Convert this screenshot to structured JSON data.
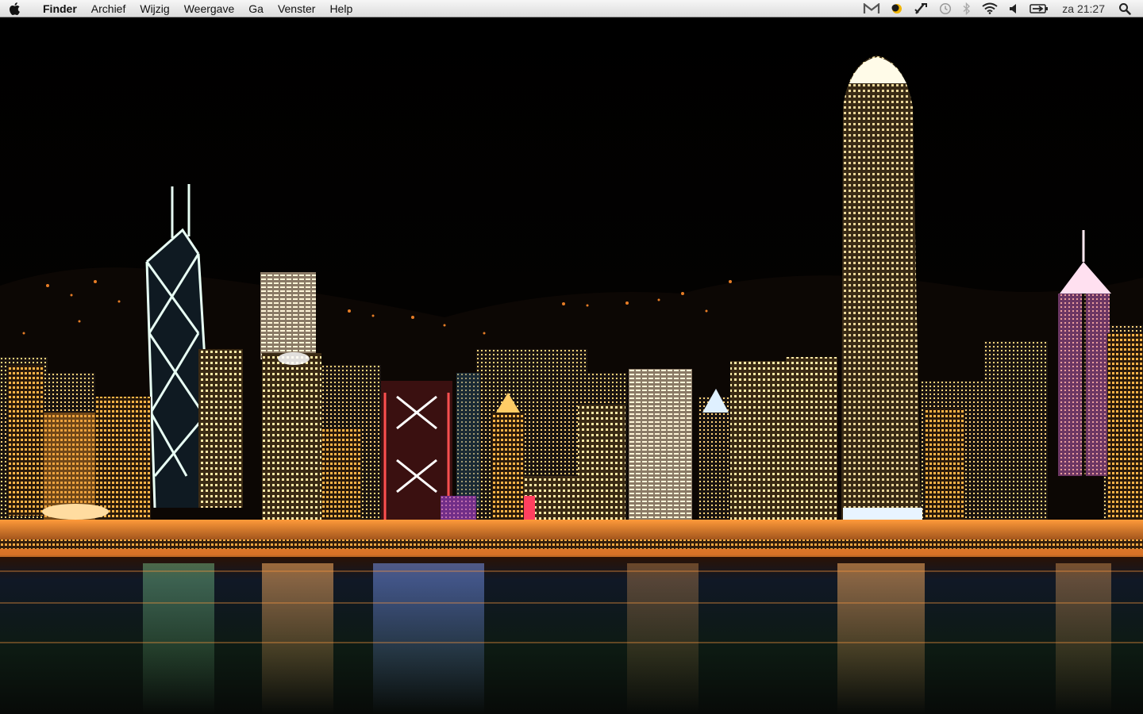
{
  "menubar": {
    "apple_icon": "apple-icon",
    "app_name": "Finder",
    "items": [
      "Archief",
      "Wijzig",
      "Weergave",
      "Ga",
      "Venster",
      "Help"
    ],
    "status_icons": [
      "gmail-notifier-icon",
      "growl-icon",
      "script-icon",
      "time-machine-icon",
      "bluetooth-icon",
      "wifi-icon",
      "volume-icon",
      "battery-icon"
    ],
    "clock": "za 21:27",
    "spotlight_icon": "spotlight-search-icon"
  },
  "desktop": {
    "wallpaper": "city-skyline-night-icon"
  }
}
